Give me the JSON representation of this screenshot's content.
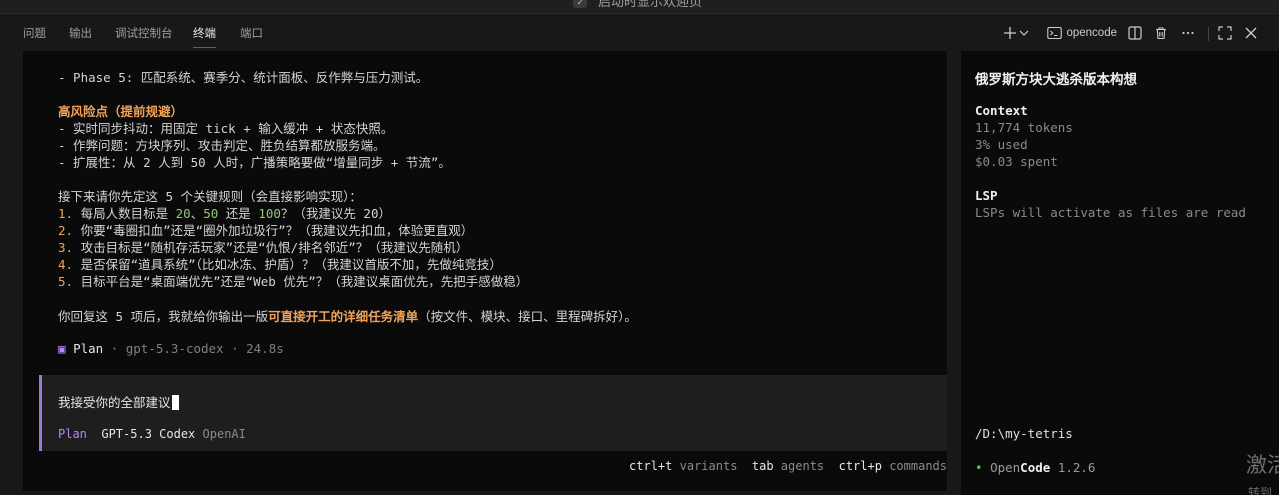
{
  "titlebar": {
    "text": "启动时显示欢迎页"
  },
  "panel_tabs": [
    {
      "label": "问题"
    },
    {
      "label": "输出"
    },
    {
      "label": "调试控制台"
    },
    {
      "label": "终端"
    },
    {
      "label": "端口"
    }
  ],
  "active_tab": "终端",
  "actions": {
    "terminal_name": "opencode"
  },
  "terminal": {
    "phase_line": "- Phase 5: 匹配系统、赛季分、统计面板、反作弊与压力测试。",
    "risk_title": "高风险点（提前规避）",
    "risks": [
      "- 实时同步抖动：用固定 tick + 输入缓冲 + 状态快照。",
      "- 作弊问题：方块序列、攻击判定、胜负结算都放服务端。",
      "- 扩展性：从 2 人到 50 人时，广播策略要做“增量同步 + 节流”。"
    ],
    "rules_intro": "接下来请你先定这 5 个关键规则（会直接影响实现）：",
    "rules": [
      {
        "num": "1.",
        "pre": " 每局人数目标是 ",
        "a": "20",
        "mid1": "、",
        "b": "50",
        "mid2": " 还是 ",
        "c": "100",
        "post": "？（我建议先 20）"
      },
      {
        "num": "2.",
        "text": " 你要“毒圈扣血”还是“圈外加垃圾行”？（我建议先扣血，体验更直观）"
      },
      {
        "num": "3.",
        "text": " 攻击目标是“随机存活玩家”还是“仇恨/排名邻近”？（我建议先随机）"
      },
      {
        "num": "4.",
        "text": " 是否保留“道具系统”（比如冰冻、护盾）？（我建议首版不加，先做纯竞技）"
      },
      {
        "num": "5.",
        "text": " 目标平台是“桌面端优先”还是“Web 优先”？（我建议桌面优先，先把手感做稳）"
      }
    ],
    "closing_pre": "你回复这 5 项后，我就给你输出一版",
    "closing_bold": "可直接开工的详细任务清单",
    "closing_post": "（按文件、模块、接口、里程碑拆好）。",
    "plan_line": {
      "icon": "▣",
      "mode": "Plan",
      "meta": " · gpt-5.3-codex · 24.8s"
    },
    "prompt": {
      "input": "我接受你的全部建议",
      "mode": "Plan",
      "model": "GPT-5.3 Codex",
      "provider": "OpenAI"
    },
    "hints": [
      {
        "key": "ctrl+t",
        "desc": "variants"
      },
      {
        "key": "tab",
        "desc": "agents"
      },
      {
        "key": "ctrl+p",
        "desc": "commands"
      }
    ]
  },
  "sidebar": {
    "title": "俄罗斯方块大逃杀版本构想",
    "context_heading": "Context",
    "tokens": "11,774 tokens",
    "used": "3% used",
    "spent": "$0.03 spent",
    "lsp_heading": "LSP",
    "lsp_text": "LSPs will activate as files are read",
    "path": "/D:\\my-tetris",
    "version": {
      "dot": "•",
      "open": "Open",
      "code": "Code",
      "number": "1.2.6"
    }
  },
  "watermark": {
    "line1": "激活",
    "line2": "转到"
  },
  "colors": {
    "accent_tab": "#0078d4",
    "plan_purple": "#9d7cd8",
    "orange": "#f0a35a",
    "green_numbers": "#8fc97a",
    "status_dot": "#5fbf5f"
  }
}
